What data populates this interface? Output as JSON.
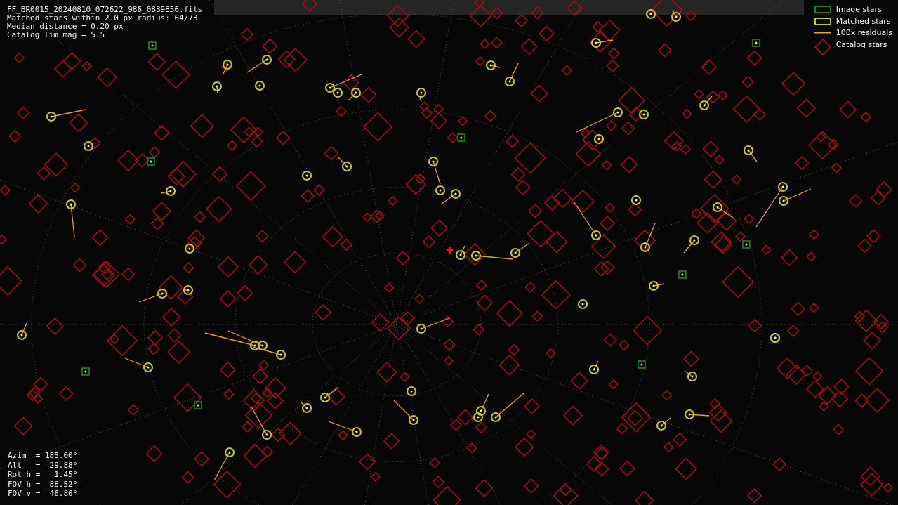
{
  "info_lines": [
    "FF_BR0015_20240810_072622_986_0889856.fits",
    "Matched stars within 2.0 px radius: 64/73",
    "Median distance = 0.20 px",
    "Catalog lim mag = 5.5"
  ],
  "legend": [
    {
      "kind": "image",
      "label": "Image stars"
    },
    {
      "kind": "matched",
      "label": "Matched stars"
    },
    {
      "kind": "residual",
      "label": "100x residuals"
    },
    {
      "kind": "catalog",
      "label": "Catalog stars"
    }
  ],
  "pointing": [
    "Azim  = 185.00°",
    "Alt   =  29.88°",
    "Rot h =   1.45°",
    "FOV h =  88.52°",
    "FOV v =  46.86°"
  ]
}
